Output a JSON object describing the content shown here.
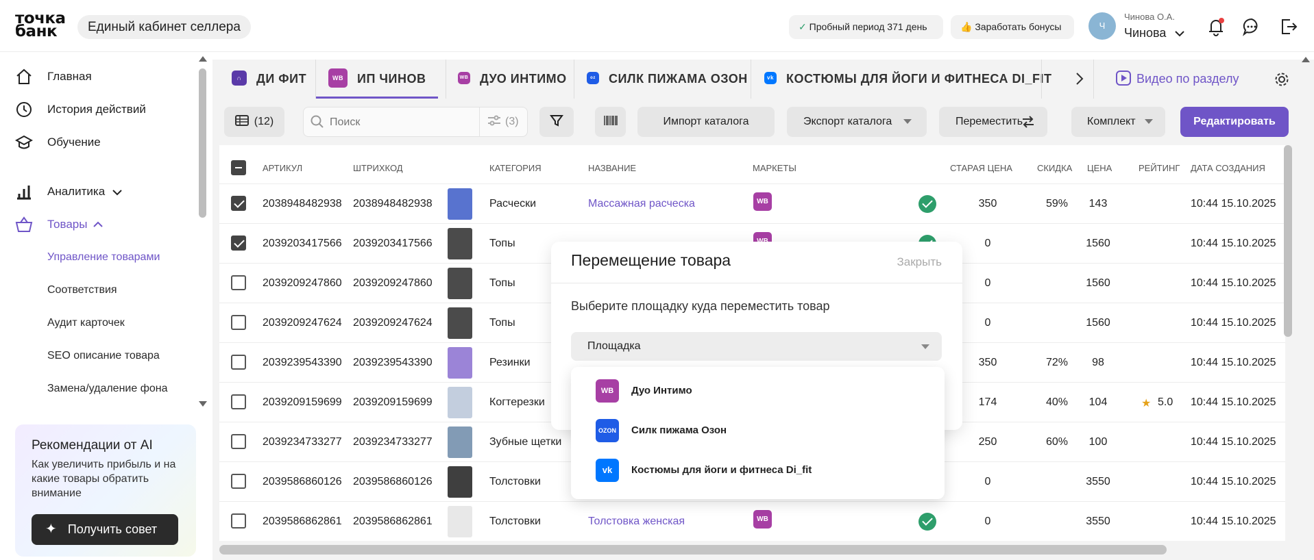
{
  "header": {
    "logo_line1": "точка",
    "logo_line2": "банк",
    "cabinet_title": "Единый кабинет селлера",
    "trial_label": "Пробный период 371 день",
    "bonus_label": "Заработать бонусы",
    "avatar_letter": "Ч",
    "user_name_small": "Чинова О.А.",
    "user_name": "Чинова"
  },
  "sidebar": {
    "items": [
      {
        "label": "Главная",
        "icon": "home-icon"
      },
      {
        "label": "История действий",
        "icon": "history-icon"
      },
      {
        "label": "Обучение",
        "icon": "education-icon"
      },
      {
        "label": "Аналитика",
        "icon": "analytics-icon"
      },
      {
        "label": "Товары",
        "icon": "basket-icon"
      }
    ],
    "subitems": [
      "Управление товарами",
      "Соответствия",
      "Аудит карточек",
      "SEO описание товара",
      "Замена/удаление фона"
    ],
    "ai_card": {
      "title": "Рекомендации от AI",
      "text": "Как увеличить прибыль и на какие товары обратить внимание",
      "button": "Получить совет"
    }
  },
  "tabs": [
    {
      "label": "ДИ ФИТ"
    },
    {
      "label": "ИП ЧИНОВ",
      "icon": "WB"
    },
    {
      "label": "ДУО ИНТИМО",
      "icon": "WB"
    },
    {
      "label": "СИЛК ПИЖАМА ОЗОН",
      "icon": "ozon"
    },
    {
      "label": "КОСТЮМЫ ДЛЯ ЙОГИ И ФИТНЕСА DI_FIT",
      "icon": "vk"
    }
  ],
  "video_link": "Видео по разделу",
  "toolbar": {
    "table_count": "(12)",
    "search_placeholder": "Поиск",
    "filter_count": "(3)",
    "import": "Импорт каталога",
    "export": "Экспорт каталога",
    "move": "Переместить",
    "kit": "Комплект",
    "edit": "Редактировать"
  },
  "table": {
    "columns": [
      "АРТИКУЛ",
      "ШТРИХКОД",
      "КАТЕГОРИЯ",
      "НАЗВАНИЕ",
      "МАРКЕТЫ",
      "СТАРАЯ ЦЕНА",
      "СКИДКА",
      "ЦЕНА",
      "РЕЙТИНГ",
      "ДАТА СОЗДАНИЯ"
    ],
    "rows": [
      {
        "checked": true,
        "article": "2038948482938",
        "barcode": "2038948482938",
        "category": "Расчески",
        "name": "Массажная расческа",
        "old_price": "350",
        "discount": "59%",
        "price": "143",
        "rating": "",
        "date": "10:44 15.10.2025"
      },
      {
        "checked": true,
        "article": "2039203417566",
        "barcode": "2039203417566",
        "category": "Топы",
        "name": "",
        "old_price": "0",
        "discount": "",
        "price": "1560",
        "rating": "",
        "date": "10:44 15.10.2025"
      },
      {
        "checked": false,
        "article": "2039209247860",
        "barcode": "2039209247860",
        "category": "Топы",
        "name": "",
        "old_price": "0",
        "discount": "",
        "price": "1560",
        "rating": "",
        "date": "10:44 15.10.2025"
      },
      {
        "checked": false,
        "article": "2039209247624",
        "barcode": "2039209247624",
        "category": "Топы",
        "name": "",
        "old_price": "0",
        "discount": "",
        "price": "1560",
        "rating": "",
        "date": "10:44 15.10.2025"
      },
      {
        "checked": false,
        "article": "2039239543390",
        "barcode": "2039239543390",
        "category": "Резинки",
        "name": "",
        "old_price": "350",
        "discount": "72%",
        "price": "98",
        "rating": "",
        "date": "10:44 15.10.2025"
      },
      {
        "checked": false,
        "article": "2039209159699",
        "barcode": "2039209159699",
        "category": "Когтерезки",
        "name": "",
        "old_price": "174",
        "discount": "40%",
        "price": "104",
        "rating": "5.0",
        "date": "10:44 15.10.2025"
      },
      {
        "checked": false,
        "article": "2039234733277",
        "barcode": "2039234733277",
        "category": "Зубные щетки",
        "name": "",
        "old_price": "250",
        "discount": "60%",
        "price": "100",
        "rating": "",
        "date": "10:44 15.10.2025"
      },
      {
        "checked": false,
        "article": "2039586860126",
        "barcode": "2039586860126",
        "category": "Толстовки",
        "name": "",
        "old_price": "0",
        "discount": "",
        "price": "3550",
        "rating": "",
        "date": "10:44 15.10.2025"
      },
      {
        "checked": false,
        "article": "2039586862861",
        "barcode": "2039586862861",
        "category": "Толстовки",
        "name": "Толстовка женская",
        "old_price": "0",
        "discount": "",
        "price": "3550",
        "rating": "",
        "date": "10:44 15.10.2025"
      }
    ]
  },
  "modal": {
    "title": "Перемещение товара",
    "close": "Закрыть",
    "prompt": "Выберите площадку куда переместить товар",
    "select_label": "Площадка",
    "options": [
      {
        "label": "Дуо Интимо",
        "icon": "WB"
      },
      {
        "label": "Силк пижама Озон",
        "icon": "OZON"
      },
      {
        "label": "Костюмы для йоги и фитнеса Di_fit",
        "icon": "vk"
      }
    ]
  },
  "colors": {
    "accent": "#6f55c7",
    "wb": "#a73fa4",
    "ozon": "#1f5ce6",
    "vk": "#0077ff",
    "ok": "#2e9e6b"
  }
}
